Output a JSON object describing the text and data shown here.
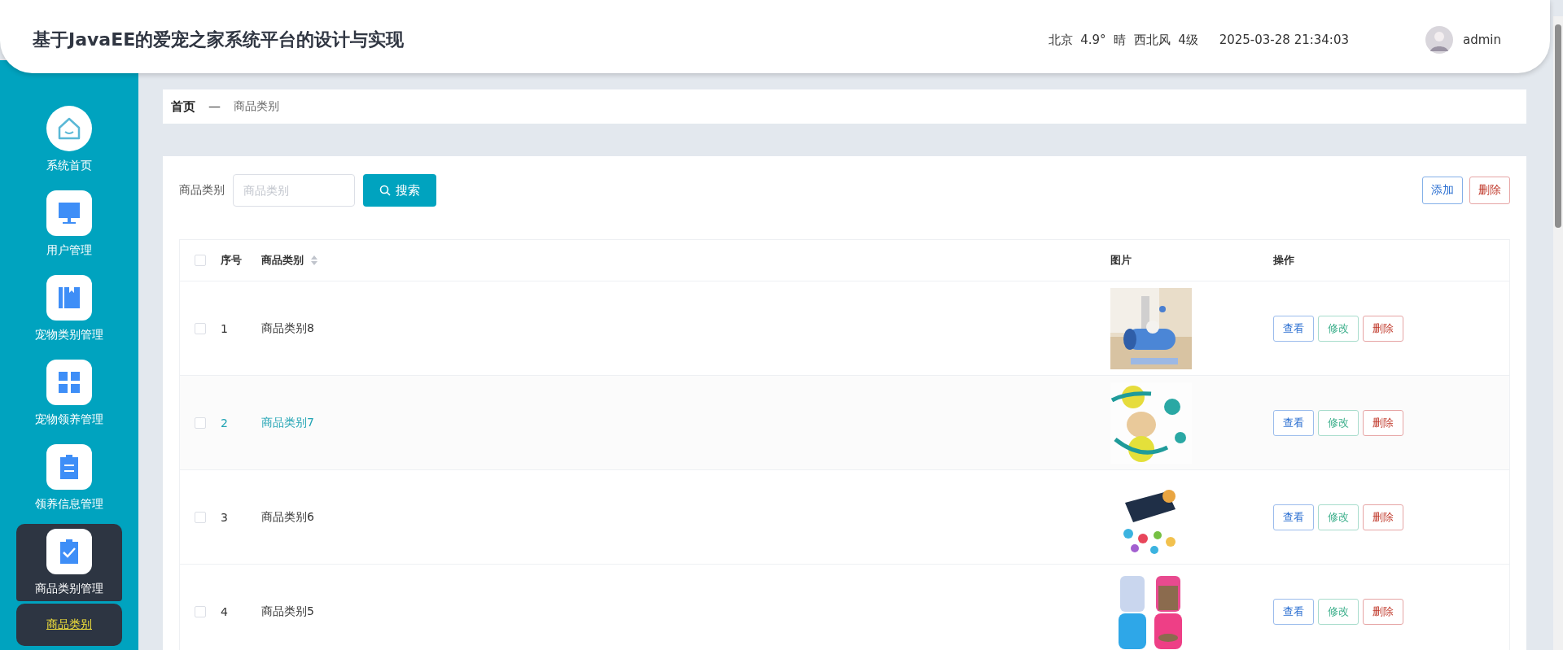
{
  "header": {
    "title": "基于JavaEE的爱宠之家系统平台的设计与实现",
    "weather": "北京  4.9°  晴  西北风  4级",
    "datetime": "2025-03-28 21:34:03",
    "user": "admin"
  },
  "sidebar": {
    "items": [
      {
        "label": "系统首页",
        "selected": false
      },
      {
        "label": "用户管理",
        "selected": false
      },
      {
        "label": "宠物类别管理",
        "selected": false
      },
      {
        "label": "宠物领养管理",
        "selected": false
      },
      {
        "label": "领养信息管理",
        "selected": false
      },
      {
        "label": "商品类别管理",
        "selected": true,
        "expanded": true,
        "children": [
          {
            "label": "商品类别",
            "selected": true
          }
        ]
      }
    ]
  },
  "breadcrumb": [
    "首页",
    "—",
    "商品类别"
  ],
  "search": {
    "label": "商品类别",
    "placeholder": "商品类别",
    "button": "搜索"
  },
  "actions": [
    {
      "label": "添加",
      "kind": "primary"
    },
    {
      "label": "删除",
      "kind": "danger"
    }
  ],
  "table": {
    "header_checked": false,
    "columns": [
      "序号",
      "商品类别",
      "图片",
      "操作"
    ],
    "rows": [
      {
        "checked": false,
        "hovered": false,
        "index": "1",
        "name": "商品类别8",
        "picture": {
          "kind": "picture"
        },
        "buttons": [
          {
            "label": "查看",
            "kind": "view"
          },
          {
            "label": "修改",
            "kind": "edit"
          },
          {
            "label": "删除",
            "kind": "delete"
          }
        ]
      },
      {
        "checked": false,
        "hovered": true,
        "index": "2",
        "name": "商品类别7",
        "picture": {
          "kind": "picture"
        },
        "buttons": [
          {
            "label": "查看",
            "kind": "view"
          },
          {
            "label": "修改",
            "kind": "edit"
          },
          {
            "label": "删除",
            "kind": "delete"
          }
        ]
      },
      {
        "checked": false,
        "hovered": false,
        "index": "3",
        "name": "商品类别6",
        "picture": {
          "kind": "picture"
        },
        "buttons": [
          {
            "label": "查看",
            "kind": "view"
          },
          {
            "label": "修改",
            "kind": "edit"
          },
          {
            "label": "删除",
            "kind": "delete"
          }
        ]
      },
      {
        "checked": false,
        "hovered": false,
        "index": "4",
        "name": "商品类别5",
        "picture": {
          "kind": "picture"
        },
        "buttons": [
          {
            "label": "查看",
            "kind": "view"
          },
          {
            "label": "修改",
            "kind": "edit"
          },
          {
            "label": "删除",
            "kind": "delete"
          }
        ]
      }
    ]
  }
}
